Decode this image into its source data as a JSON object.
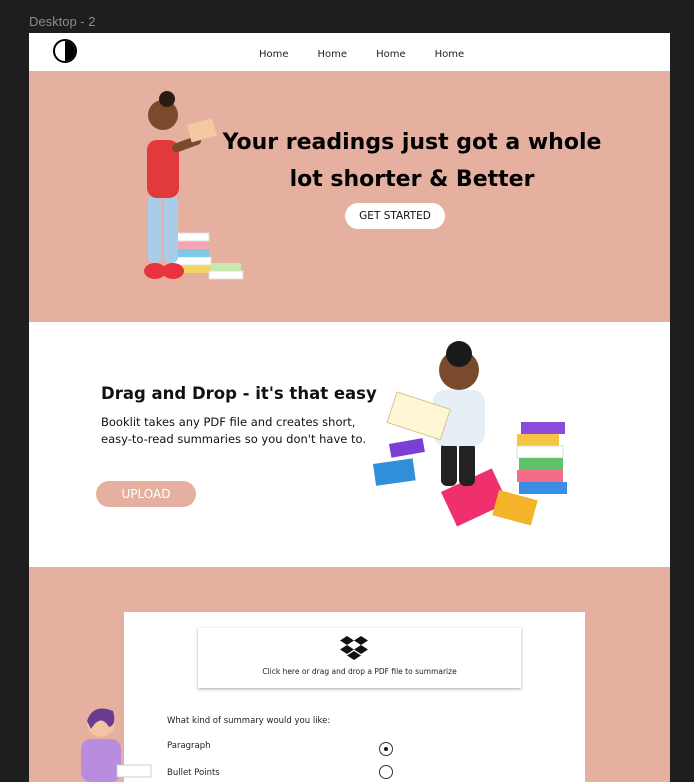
{
  "frame": {
    "title": "Desktop - 2"
  },
  "nav": {
    "links": [
      "Home",
      "Home",
      "Home",
      "Home"
    ]
  },
  "hero": {
    "title_line1": "Your readings just got a whole",
    "title_line2": "lot shorter & Better",
    "cta_label": "GET STARTED"
  },
  "feature": {
    "title": "Drag and Drop - it's that easy",
    "body": "Booklit takes any PDF file and creates short, easy-to-read summaries so you don't have to.",
    "upload_label": "UPLOAD"
  },
  "summarize": {
    "dropzone_text": "Click here or drag and drop a PDF file to summarize",
    "question": "What kind of summary would you like:",
    "options": [
      {
        "label": "Paragraph",
        "selected": true
      },
      {
        "label": "Bullet Points",
        "selected": false
      }
    ]
  },
  "colors": {
    "accent": "#e5b09f",
    "canvas": "#1e1e1e"
  }
}
